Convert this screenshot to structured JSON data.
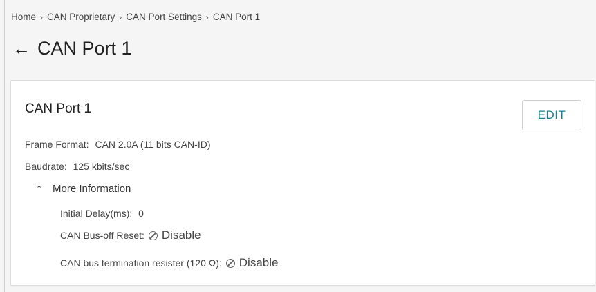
{
  "breadcrumb": {
    "items": [
      "Home",
      "CAN Proprietary",
      "CAN Port Settings",
      "CAN Port 1"
    ],
    "separator": "›"
  },
  "header": {
    "back_icon": "arrow-left-icon",
    "title": "CAN Port 1"
  },
  "card": {
    "title": "CAN Port 1",
    "edit_label": "EDIT",
    "frame_format_label": "Frame Format:",
    "frame_format_value": "CAN 2.0A (11 bits CAN-ID)",
    "baudrate_label": "Baudrate:",
    "baudrate_value": "125 kbits/sec",
    "more_info": {
      "label": "More Information",
      "expanded": true,
      "initial_delay_label": "Initial Delay(ms):",
      "initial_delay_value": "0",
      "bus_off_reset_label": "CAN Bus-off Reset:",
      "bus_off_reset_value": "Disable",
      "termination_label": "CAN bus termination resister (120 Ω):",
      "termination_value": "Disable"
    }
  },
  "colors": {
    "accent": "#1a7f8e",
    "background": "#f5f5f5"
  }
}
